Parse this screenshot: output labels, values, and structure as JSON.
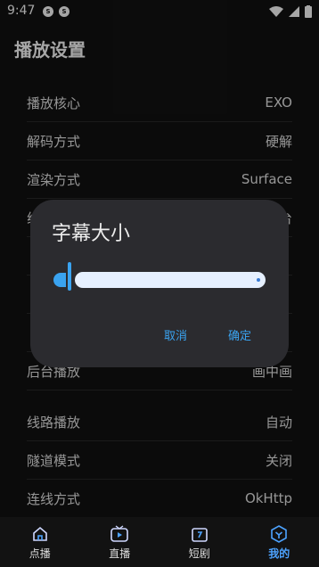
{
  "status": {
    "time": "9:47",
    "noti1": "S",
    "noti2": "S"
  },
  "title": "播放设置",
  "settings": [
    {
      "label": "播放核心",
      "value": "EXO"
    },
    {
      "label": "解码方式",
      "value": "硬解"
    },
    {
      "label": "渲染方式",
      "value": "Surface"
    },
    {
      "label": "线",
      "value": "台"
    },
    {
      "label": "",
      "value": ""
    },
    {
      "label": "",
      "value": ""
    },
    {
      "label": "",
      "value": ""
    },
    {
      "label": "后台播放",
      "value": "画中画"
    },
    {
      "label": "线路播放",
      "value": "自动"
    },
    {
      "label": "隧道模式",
      "value": "关闭"
    },
    {
      "label": "连线方式",
      "value": "OkHttp"
    }
  ],
  "dialog": {
    "title": "字幕大小",
    "cancel": "取消",
    "ok": "确定",
    "slider_fraction": 0.02
  },
  "nav": [
    {
      "label": "点播",
      "icon": "home-icon"
    },
    {
      "label": "直播",
      "icon": "live-tv-icon"
    },
    {
      "label": "短剧",
      "icon": "short-drama-icon"
    },
    {
      "label": "我的",
      "icon": "profile-icon",
      "active": true
    }
  ],
  "colors": {
    "accent": "#3aa3f0",
    "background": "#121212",
    "dialog": "#2b2b2f"
  }
}
